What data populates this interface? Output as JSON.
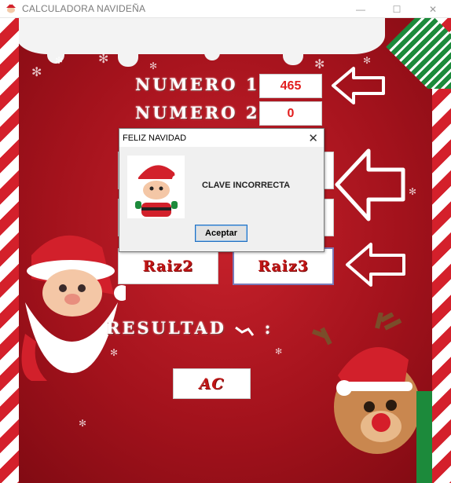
{
  "window": {
    "title": "CALCULADORA NAVIDEÑA",
    "minimize_glyph": "—",
    "maximize_glyph": "☐",
    "close_glyph": "✕"
  },
  "form": {
    "numero1_label": "NUMERO 1:",
    "numero1_value": "465",
    "numero2_label": "NUMERO 2:",
    "numero2_value": "0",
    "raiz2_label": "Raiz2",
    "raiz3_label": "Raiz3",
    "resultado_label": "RESULTAD",
    "ac_label": "AC"
  },
  "dialog": {
    "title": "FELIZ NAVIDAD",
    "close_glyph": "✕",
    "message": "CLAVE INCORRECTA",
    "ok_label": "Aceptar"
  },
  "colors": {
    "background_red": "#a3121c",
    "digit_red": "#e21d1d",
    "stripe_red": "#d4202b",
    "ribbon_green": "#1c8a3b"
  },
  "icons": {
    "app": "santa-icon",
    "dialog": "santa-icon",
    "arrows": "arrow-left-icon"
  }
}
